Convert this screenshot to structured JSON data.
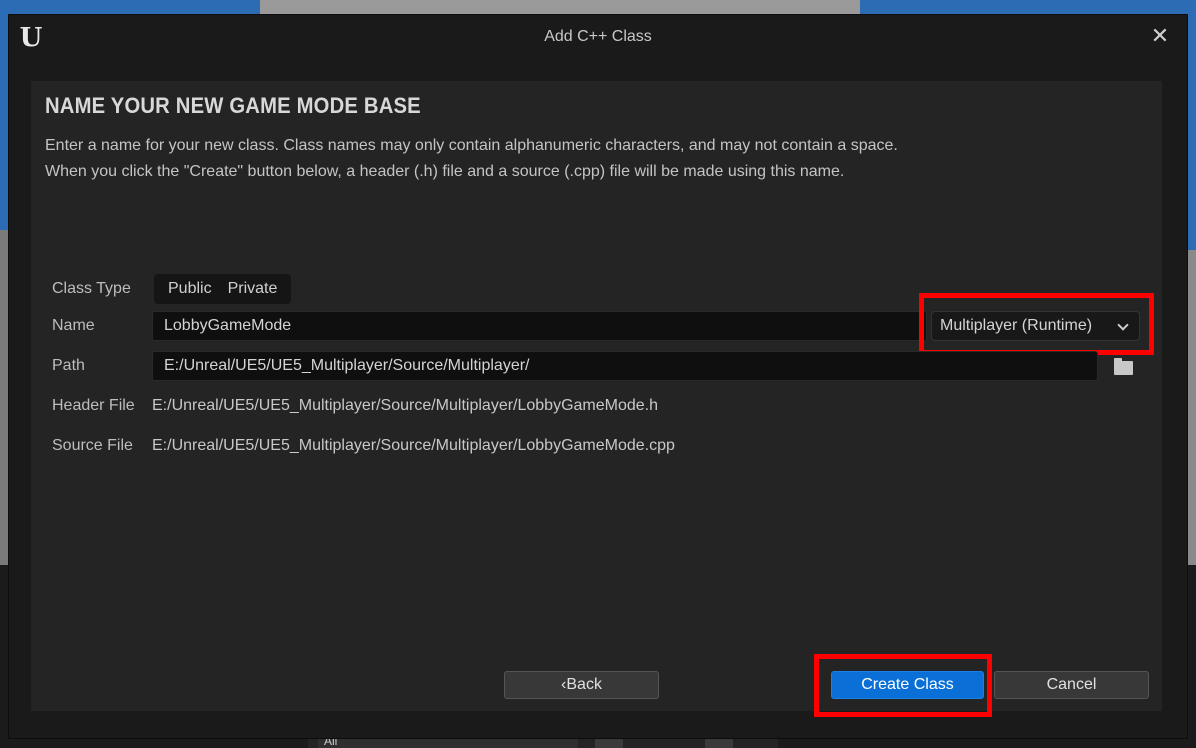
{
  "window": {
    "title": "Add C++ Class",
    "logo_icon": "unreal-logo-icon",
    "close_icon": "close-icon"
  },
  "page": {
    "heading": "NAME YOUR NEW GAME MODE BASE",
    "description_line1": "Enter a name for your new class. Class names may only contain alphanumeric characters, and may not contain a space.",
    "description_line2": "When you click the \"Create\" button below, a header (.h) file and a source (.cpp) file will be made using this name."
  },
  "form": {
    "class_type_label": "Class Type",
    "class_type_options": [
      "Public",
      "Private"
    ],
    "name_label": "Name",
    "name_value": "LobbyGameMode",
    "module_dropdown": "Multiplayer (Runtime)",
    "path_label": "Path",
    "path_value": "E:/Unreal/UE5/UE5_Multiplayer/Source/Multiplayer/",
    "header_file_label": "Header File",
    "header_file_value": "E:/Unreal/UE5/UE5_Multiplayer/Source/Multiplayer/LobbyGameMode.h",
    "source_file_label": "Source File",
    "source_file_value": "E:/Unreal/UE5/UE5_Multiplayer/Source/Multiplayer/LobbyGameMode.cpp"
  },
  "buttons": {
    "back": "Back",
    "create": "Create Class",
    "cancel": "Cancel"
  },
  "background": {
    "tree_item": "All"
  },
  "colors": {
    "highlight": "#ff0000",
    "primary_button": "#0a70d8"
  }
}
